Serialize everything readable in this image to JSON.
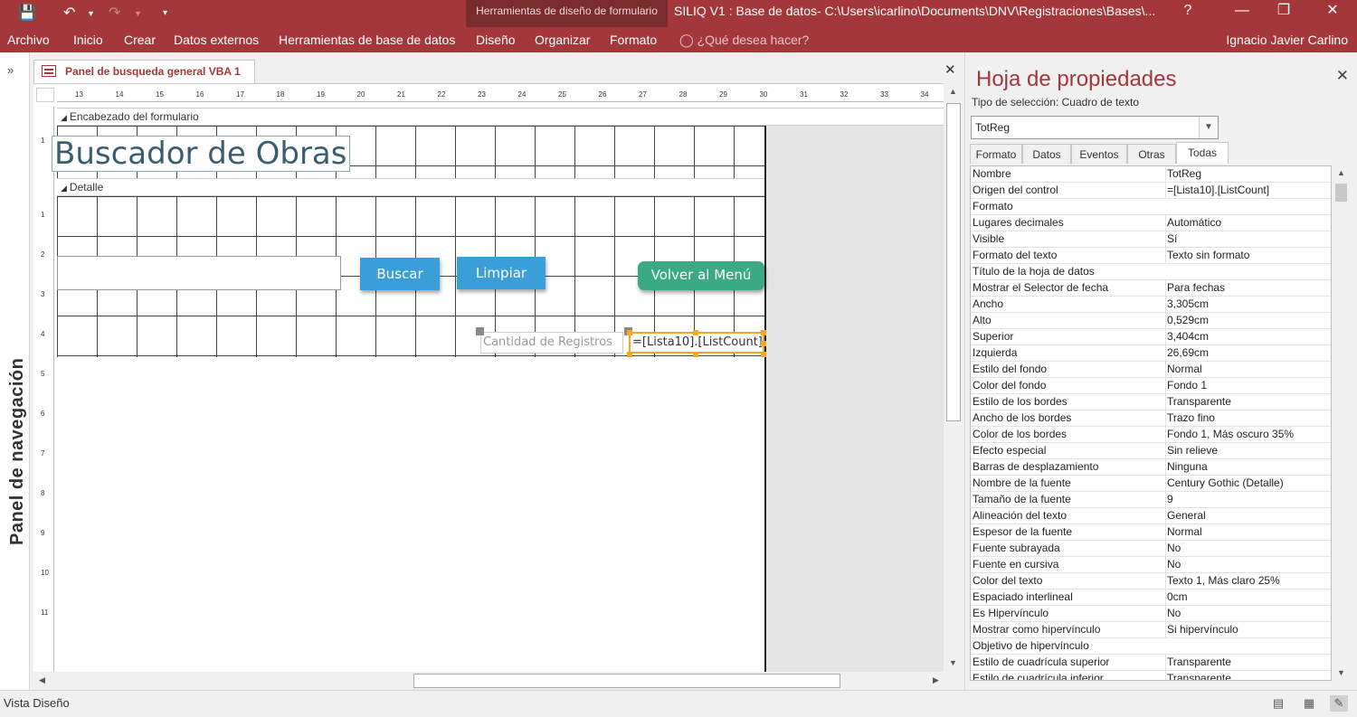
{
  "window": {
    "title": "SILIQ V1 : Base de datos- C:\\Users\\icarlino\\Documents\\DNV\\Registraciones\\Bases\\...",
    "contextual_group": "Herramientas de diseño de formulario",
    "help": "?"
  },
  "ribbon": {
    "tabs": [
      "Archivo",
      "Inicio",
      "Crear",
      "Datos externos",
      "Herramientas de base de datos",
      "Diseño",
      "Organizar",
      "Formato"
    ],
    "tell_me": "¿Qué desea hacer?",
    "user": "Ignacio Javier Carlino"
  },
  "nav": {
    "title": "Panel de navegación"
  },
  "document": {
    "tab_title": "Panel de busqueda general VBA 1"
  },
  "rulers": {
    "h": [
      "13",
      "14",
      "15",
      "16",
      "17",
      "18",
      "19",
      "20",
      "21",
      "22",
      "23",
      "24",
      "25",
      "26",
      "27",
      "28",
      "29",
      "30",
      "31",
      "32",
      "33",
      "34"
    ],
    "v": [
      "1",
      "1",
      "2",
      "3",
      "4",
      "5",
      "6",
      "7",
      "8",
      "9",
      "10",
      "11"
    ]
  },
  "form": {
    "header_section": "Encabezado del formulario",
    "detail_section": "Detalle",
    "title_label": "Buscador de Obras",
    "search_button": "Buscar",
    "clear_button": "Limpiar",
    "menu_button": "Volver al Menú",
    "count_label": "Cantidad de Registros",
    "count_textbox": "=[Lista10].[ListCount]"
  },
  "props": {
    "title": "Hoja de propiedades",
    "selection_type": "Tipo de selección:  Cuadro de texto",
    "object": "TotReg",
    "tabs": [
      "Formato",
      "Datos",
      "Eventos",
      "Otras",
      "Todas"
    ],
    "active_tab": "Todas",
    "rows": [
      {
        "k": "Nombre",
        "v": "TotReg"
      },
      {
        "k": "Origen del control",
        "v": "=[Lista10].[ListCount]"
      },
      {
        "k": "Formato",
        "v": ""
      },
      {
        "k": "Lugares decimales",
        "v": "Automático"
      },
      {
        "k": "Visible",
        "v": "Sí"
      },
      {
        "k": "Formato del texto",
        "v": "Texto sin formato"
      },
      {
        "k": "Título de la hoja de datos",
        "v": ""
      },
      {
        "k": "Mostrar el Selector de fecha",
        "v": "Para fechas"
      },
      {
        "k": "Ancho",
        "v": "3,305cm"
      },
      {
        "k": "Alto",
        "v": "0,529cm"
      },
      {
        "k": "Superior",
        "v": "3,404cm"
      },
      {
        "k": "Izquierda",
        "v": "26,69cm"
      },
      {
        "k": "Estilo del fondo",
        "v": "Normal"
      },
      {
        "k": "Color del fondo",
        "v": "Fondo 1"
      },
      {
        "k": "Estilo de los bordes",
        "v": "Transparente"
      },
      {
        "k": "Ancho de los bordes",
        "v": "Trazo fino"
      },
      {
        "k": "Color de los bordes",
        "v": "Fondo 1, Más oscuro 35%"
      },
      {
        "k": "Efecto especial",
        "v": "Sin relieve"
      },
      {
        "k": "Barras de desplazamiento",
        "v": "Ninguna"
      },
      {
        "k": "Nombre de la fuente",
        "v": "Century Gothic (Detalle)"
      },
      {
        "k": "Tamaño de la fuente",
        "v": "9"
      },
      {
        "k": "Alineación del texto",
        "v": "General"
      },
      {
        "k": "Espesor de la fuente",
        "v": "Normal"
      },
      {
        "k": "Fuente subrayada",
        "v": "No"
      },
      {
        "k": "Fuente en cursiva",
        "v": "No"
      },
      {
        "k": "Color del texto",
        "v": "Texto 1, Más claro 25%"
      },
      {
        "k": "Espaciado interlineal",
        "v": "0cm"
      },
      {
        "k": "Es Hipervínculo",
        "v": "No"
      },
      {
        "k": "Mostrar como hipervínculo",
        "v": "Si hipervínculo"
      },
      {
        "k": "Objetivo de hipervínculo",
        "v": ""
      },
      {
        "k": "Estilo de cuadrícula superior",
        "v": "Transparente"
      },
      {
        "k": "Estilo de cuadrícula inferior",
        "v": "Transparente"
      }
    ]
  },
  "status": {
    "text": "Vista Diseño"
  },
  "colors": {
    "brand": "#a4373a",
    "button_blue": "#3a9ed8",
    "button_green": "#3aaa84",
    "selection": "#f5a623"
  }
}
